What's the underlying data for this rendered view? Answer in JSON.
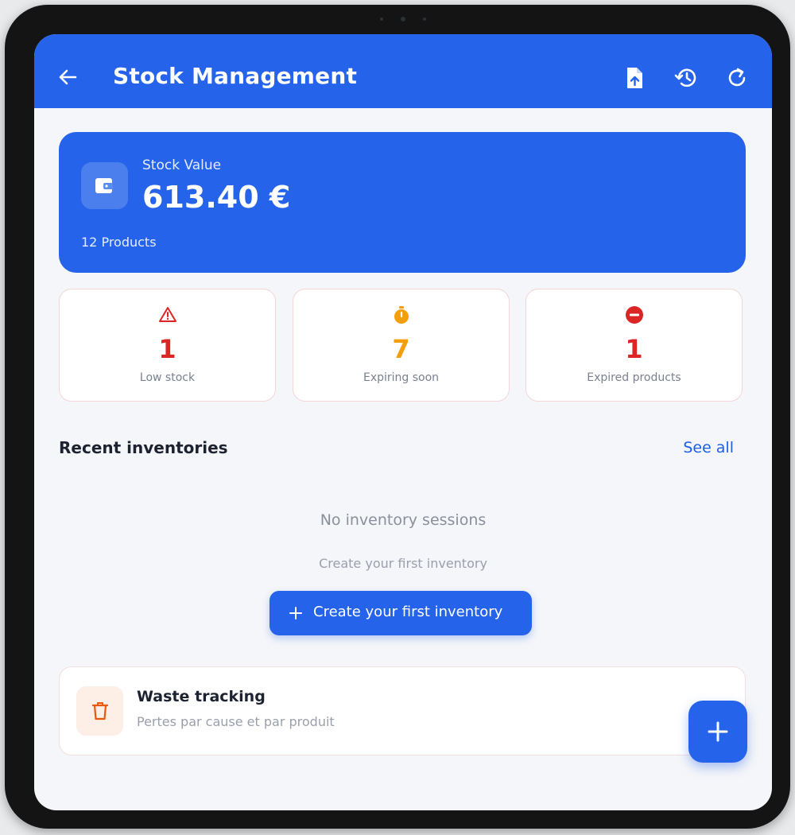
{
  "header": {
    "title": "Stock Management"
  },
  "stock_value": {
    "label": "Stock Value",
    "amount": "613.40 €",
    "products": "12 Products"
  },
  "stats": [
    {
      "value": "1",
      "label": "Low stock",
      "color": "#dc2626",
      "icon": "warning-triangle-icon"
    },
    {
      "value": "7",
      "label": "Expiring soon",
      "color": "#f59e0b",
      "icon": "timer-icon"
    },
    {
      "value": "1",
      "label": "Expired products",
      "color": "#dc2626",
      "icon": "no-entry-icon"
    }
  ],
  "recent": {
    "title": "Recent inventories",
    "see_all": "See all",
    "empty_title": "No inventory sessions",
    "empty_subtitle": "Create your first inventory",
    "create_button": "Create your first inventory"
  },
  "waste": {
    "title": "Waste tracking",
    "subtitle": "Pertes par cause et par produit"
  },
  "colors": {
    "primary": "#2563eb",
    "danger": "#dc2626",
    "warning": "#f59e0b",
    "waste_accent": "#ea580c"
  }
}
